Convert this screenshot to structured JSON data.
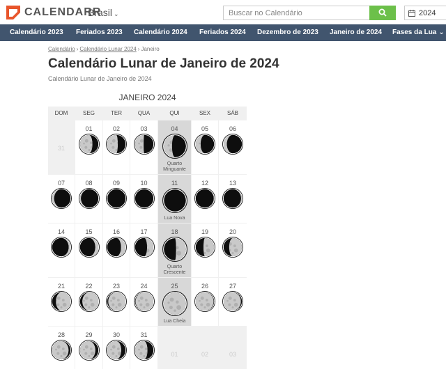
{
  "header": {
    "brand": "CALENDARR",
    "region": "Brasil",
    "search_placeholder": "Buscar no Calendário",
    "year": "2024"
  },
  "nav": [
    "Calendário 2023",
    "Feriados 2023",
    "Calendário 2024",
    "Feriados 2024",
    "Dezembro de 2023",
    "Janeiro de 2024",
    "Fases da Lua"
  ],
  "breadcrumb": [
    "Calendário",
    "Calendário Lunar 2024",
    "Janeiro"
  ],
  "page": {
    "title": "Calendário Lunar de Janeiro de 2024",
    "subtitle": "Calendário Lunar de Janeiro de 2024"
  },
  "calendar": {
    "month_title": "JANEIRO 2024",
    "weekdays": [
      "DOM",
      "SEG",
      "TER",
      "QUA",
      "QUI",
      "SEX",
      "SÁB"
    ],
    "weeks": [
      [
        {
          "day": "31",
          "muted": true
        },
        {
          "day": "01",
          "illum": 0.68,
          "waxing": false
        },
        {
          "day": "02",
          "illum": 0.58,
          "waxing": false
        },
        {
          "day": "03",
          "illum": 0.47,
          "waxing": false
        },
        {
          "day": "04",
          "illum": 0.37,
          "waxing": false,
          "label": "Quarto Minguante",
          "special": true
        },
        {
          "day": "05",
          "illum": 0.27,
          "waxing": false
        },
        {
          "day": "06",
          "illum": 0.18,
          "waxing": false
        }
      ],
      [
        {
          "day": "07",
          "illum": 0.11,
          "waxing": false
        },
        {
          "day": "08",
          "illum": 0.05,
          "waxing": false
        },
        {
          "day": "09",
          "illum": 0.02,
          "waxing": false
        },
        {
          "day": "10",
          "illum": 0.0,
          "waxing": false
        },
        {
          "day": "11",
          "illum": 0.0,
          "waxing": true,
          "label": "Lua Nova",
          "special": true
        },
        {
          "day": "12",
          "illum": 0.02,
          "waxing": true
        },
        {
          "day": "13",
          "illum": 0.05,
          "waxing": true
        }
      ],
      [
        {
          "day": "14",
          "illum": 0.1,
          "waxing": true
        },
        {
          "day": "15",
          "illum": 0.17,
          "waxing": true
        },
        {
          "day": "16",
          "illum": 0.25,
          "waxing": true
        },
        {
          "day": "17",
          "illum": 0.35,
          "waxing": true
        },
        {
          "day": "18",
          "illum": 0.45,
          "waxing": true,
          "label": "Quarto Crescente",
          "special": true
        },
        {
          "day": "19",
          "illum": 0.58,
          "waxing": true
        },
        {
          "day": "20",
          "illum": 0.7,
          "waxing": true
        }
      ],
      [
        {
          "day": "21",
          "illum": 0.8,
          "waxing": true
        },
        {
          "day": "22",
          "illum": 0.88,
          "waxing": true
        },
        {
          "day": "23",
          "illum": 0.95,
          "waxing": true
        },
        {
          "day": "24",
          "illum": 0.98,
          "waxing": true
        },
        {
          "day": "25",
          "illum": 1.0,
          "waxing": true,
          "label": "Lua Cheia",
          "special": true
        },
        {
          "day": "26",
          "illum": 0.98,
          "waxing": false
        },
        {
          "day": "27",
          "illum": 0.95,
          "waxing": false
        }
      ],
      [
        {
          "day": "28",
          "illum": 0.9,
          "waxing": false
        },
        {
          "day": "29",
          "illum": 0.84,
          "waxing": false
        },
        {
          "day": "30",
          "illum": 0.77,
          "waxing": false
        },
        {
          "day": "31",
          "illum": 0.68,
          "waxing": false
        },
        {
          "day": "01",
          "muted": true
        },
        {
          "day": "02",
          "muted": true
        },
        {
          "day": "03",
          "muted": true
        }
      ]
    ]
  },
  "colors": {
    "nav_bg": "#41556e",
    "brand_orange": "#e8552b",
    "search_green": "#6cc04a",
    "highlight_col": "#d8d8d8"
  }
}
